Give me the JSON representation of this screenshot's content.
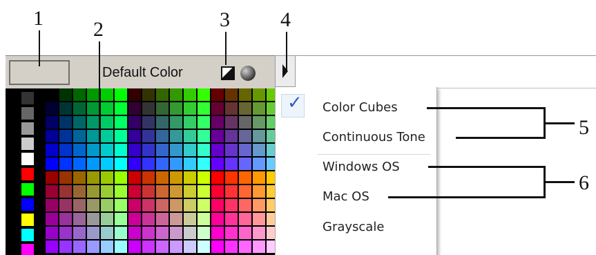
{
  "callouts": {
    "c1": "1",
    "c2": "2",
    "c3": "3",
    "c4": "4",
    "c5": "5",
    "c6": "6"
  },
  "panel": {
    "default_color_label": "Default Color",
    "icons": [
      "no-color-icon",
      "globe-icon",
      "menu-arrow-icon"
    ]
  },
  "menu": {
    "items": [
      {
        "label": "Color Cubes",
        "checked": true
      },
      {
        "label": "Continuous Tone",
        "checked": false
      },
      {
        "label": "Windows OS",
        "checked": false
      },
      {
        "label": "Mac OS",
        "checked": false
      },
      {
        "label": "Grayscale",
        "checked": false
      }
    ],
    "check_glyph": "✓"
  },
  "colors": {
    "panel_bg": "#d4d0c8",
    "check": "#3a55c8",
    "left_column": [
      "#333333",
      "#666666",
      "#999999",
      "#cccccc",
      "#ffffff",
      "#ff0000",
      "#00ff00",
      "#0000ff",
      "#ffff00",
      "#00ffff",
      "#ff00ff"
    ]
  }
}
